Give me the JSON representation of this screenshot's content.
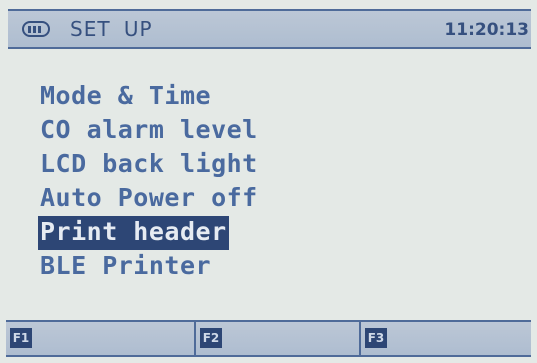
{
  "status_bar": {
    "battery_icon": "battery-icon",
    "title": "SET UP",
    "time": "11:20:13"
  },
  "menu": {
    "items": [
      {
        "label": "Mode & Time",
        "selected": false
      },
      {
        "label": "CO alarm level",
        "selected": false
      },
      {
        "label": "LCD back light",
        "selected": false
      },
      {
        "label": "Auto Power off",
        "selected": false
      },
      {
        "label": "Print header",
        "selected": true
      },
      {
        "label": "BLE Printer",
        "selected": false
      }
    ]
  },
  "function_keys": [
    {
      "label": "F1"
    },
    {
      "label": "F2"
    },
    {
      "label": "F3"
    }
  ],
  "colors": {
    "background": "#e4e9e6",
    "text": "#4a6a9f",
    "highlight": "#2d4675",
    "bar": "#b4c2d3"
  }
}
